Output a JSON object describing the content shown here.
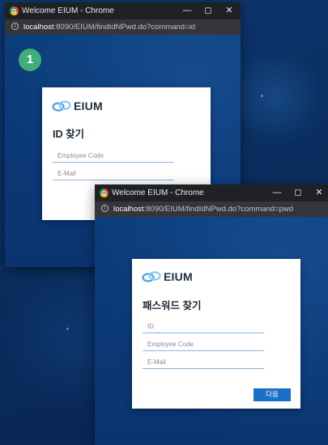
{
  "step_badge": "1",
  "window1": {
    "title": "Welcome EIUM - Chrome",
    "url_host": "localhost",
    "url_rest": ":8090/EIUM/findIdNPwd.do?command=id",
    "card": {
      "brand": "EIUM",
      "title": "ID 찾기",
      "fields": [
        {
          "placeholder": "Employee Code"
        },
        {
          "placeholder": "E-Mail"
        }
      ]
    }
  },
  "window2": {
    "title": "Welcome EIUM - Chrome",
    "url_host": "localhost",
    "url_rest": ":8090/EIUM/findIdNPwd.do?command=pwd",
    "card": {
      "brand": "EIUM",
      "title": "패스워드 찾기",
      "fields": [
        {
          "placeholder": "ID"
        },
        {
          "placeholder": "Employee Code"
        },
        {
          "placeholder": "E-Mail"
        }
      ],
      "next_label": "다음"
    }
  },
  "colors": {
    "accent": "#1a6fc9",
    "step_badge": "#3fae7a",
    "field_underline": "#8ab3d8"
  }
}
